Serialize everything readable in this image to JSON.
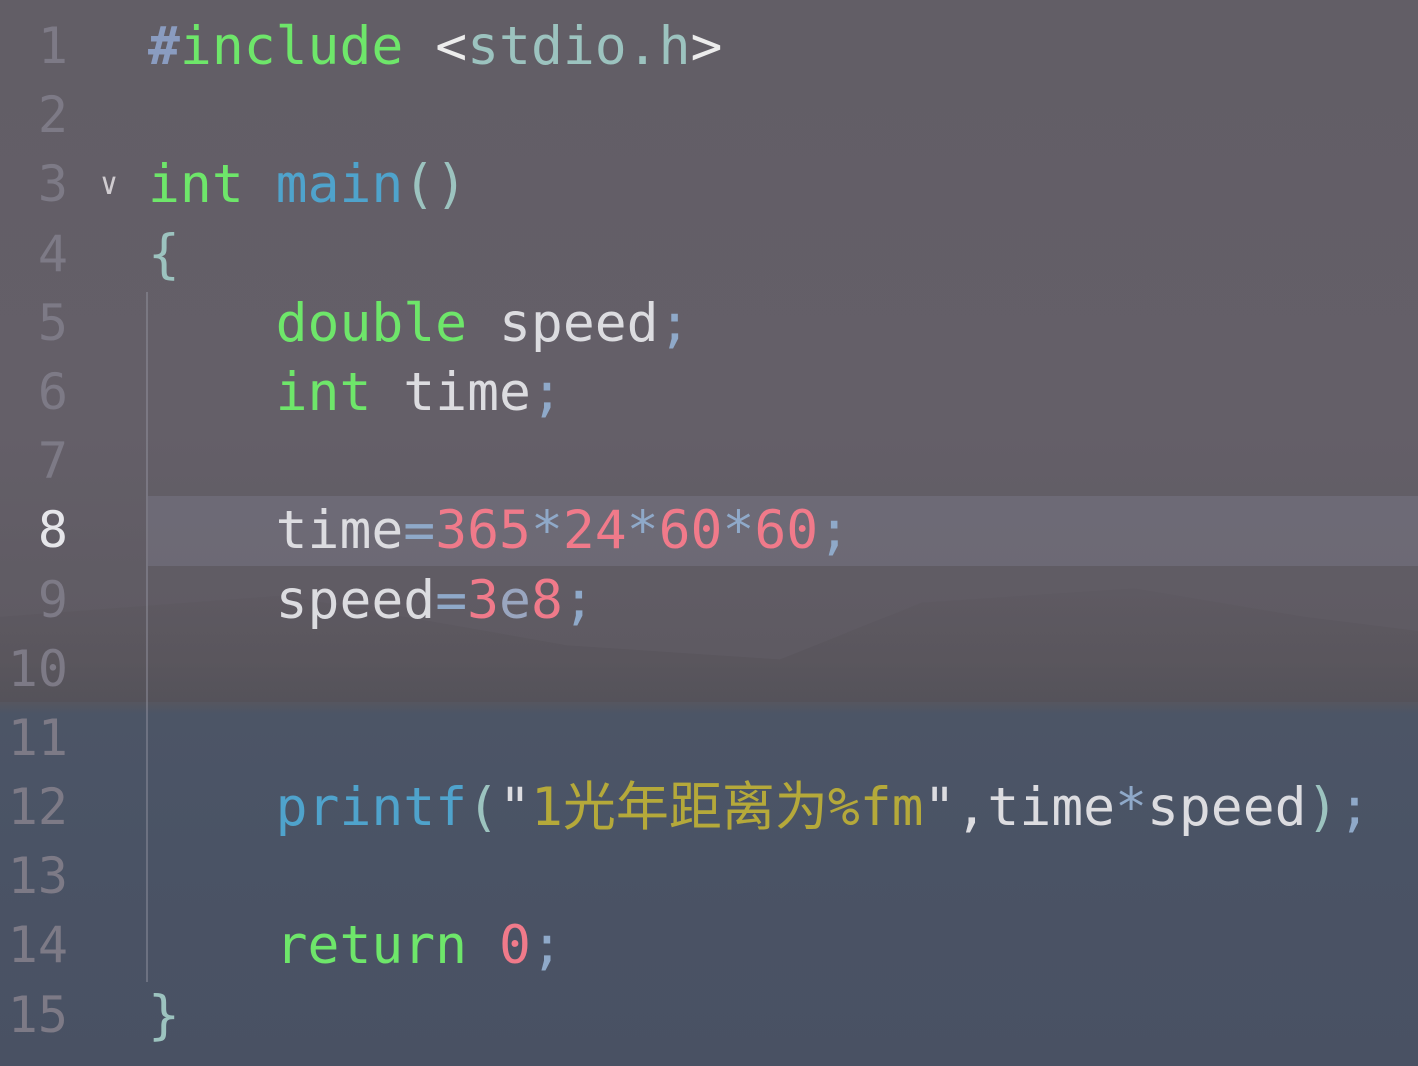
{
  "editor": {
    "active_line": 8,
    "lines": [
      {
        "n": "1",
        "fold": false,
        "tokens": [
          [
            "#",
            "hash"
          ],
          [
            "include",
            "kw"
          ],
          [
            " ",
            ""
          ],
          [
            "<",
            "ang"
          ],
          [
            "stdio.h",
            "inc"
          ],
          [
            ">",
            "ang"
          ]
        ]
      },
      {
        "n": "2",
        "fold": false,
        "tokens": []
      },
      {
        "n": "3",
        "fold": true,
        "tokens": [
          [
            "int",
            "kw"
          ],
          [
            " ",
            ""
          ],
          [
            "main",
            "fn"
          ],
          [
            "()",
            "pn"
          ]
        ]
      },
      {
        "n": "4",
        "fold": false,
        "tokens": [
          [
            "{",
            "pn"
          ]
        ]
      },
      {
        "n": "5",
        "fold": false,
        "tokens": [
          [
            "    ",
            ""
          ],
          [
            "double",
            "kw"
          ],
          [
            " ",
            ""
          ],
          [
            "speed",
            "id"
          ],
          [
            ";",
            "op"
          ]
        ]
      },
      {
        "n": "6",
        "fold": false,
        "tokens": [
          [
            "    ",
            ""
          ],
          [
            "int",
            "kw"
          ],
          [
            " ",
            ""
          ],
          [
            "time",
            "id"
          ],
          [
            ";",
            "op"
          ]
        ]
      },
      {
        "n": "7",
        "fold": false,
        "tokens": []
      },
      {
        "n": "8",
        "fold": false,
        "tokens": [
          [
            "    ",
            ""
          ],
          [
            "time",
            "id"
          ],
          [
            "=",
            "op"
          ],
          [
            "365",
            "num-lit"
          ],
          [
            "*",
            "op"
          ],
          [
            "24",
            "num-lit"
          ],
          [
            "*",
            "op"
          ],
          [
            "60",
            "num-lit"
          ],
          [
            "*",
            "op"
          ],
          [
            "60",
            "num-lit"
          ],
          [
            ";",
            "op"
          ]
        ]
      },
      {
        "n": "9",
        "fold": false,
        "tokens": [
          [
            "    ",
            ""
          ],
          [
            "speed",
            "id"
          ],
          [
            "=",
            "op"
          ],
          [
            "3",
            "num-lit"
          ],
          [
            "e",
            "e"
          ],
          [
            "8",
            "num-lit"
          ],
          [
            ";",
            "op"
          ]
        ]
      },
      {
        "n": "10",
        "fold": false,
        "tokens": []
      },
      {
        "n": "11",
        "fold": false,
        "tokens": []
      },
      {
        "n": "12",
        "fold": false,
        "tokens": [
          [
            "    ",
            ""
          ],
          [
            "printf",
            "fn"
          ],
          [
            "(",
            "pn"
          ],
          [
            "\"",
            "id"
          ],
          [
            "1光年距离为%fm",
            "str"
          ],
          [
            "\"",
            "id"
          ],
          [
            ",",
            "id"
          ],
          [
            "time",
            "id"
          ],
          [
            "*",
            "op"
          ],
          [
            "speed",
            "id"
          ],
          [
            ")",
            "pn"
          ],
          [
            ";",
            "op"
          ]
        ]
      },
      {
        "n": "13",
        "fold": false,
        "tokens": []
      },
      {
        "n": "14",
        "fold": false,
        "tokens": [
          [
            "    ",
            ""
          ],
          [
            "return",
            "kw"
          ],
          [
            " ",
            ""
          ],
          [
            "0",
            "num-lit"
          ],
          [
            ";",
            "op"
          ]
        ]
      },
      {
        "n": "15",
        "fold": false,
        "tokens": [
          [
            "}",
            "pn"
          ]
        ]
      }
    ]
  }
}
